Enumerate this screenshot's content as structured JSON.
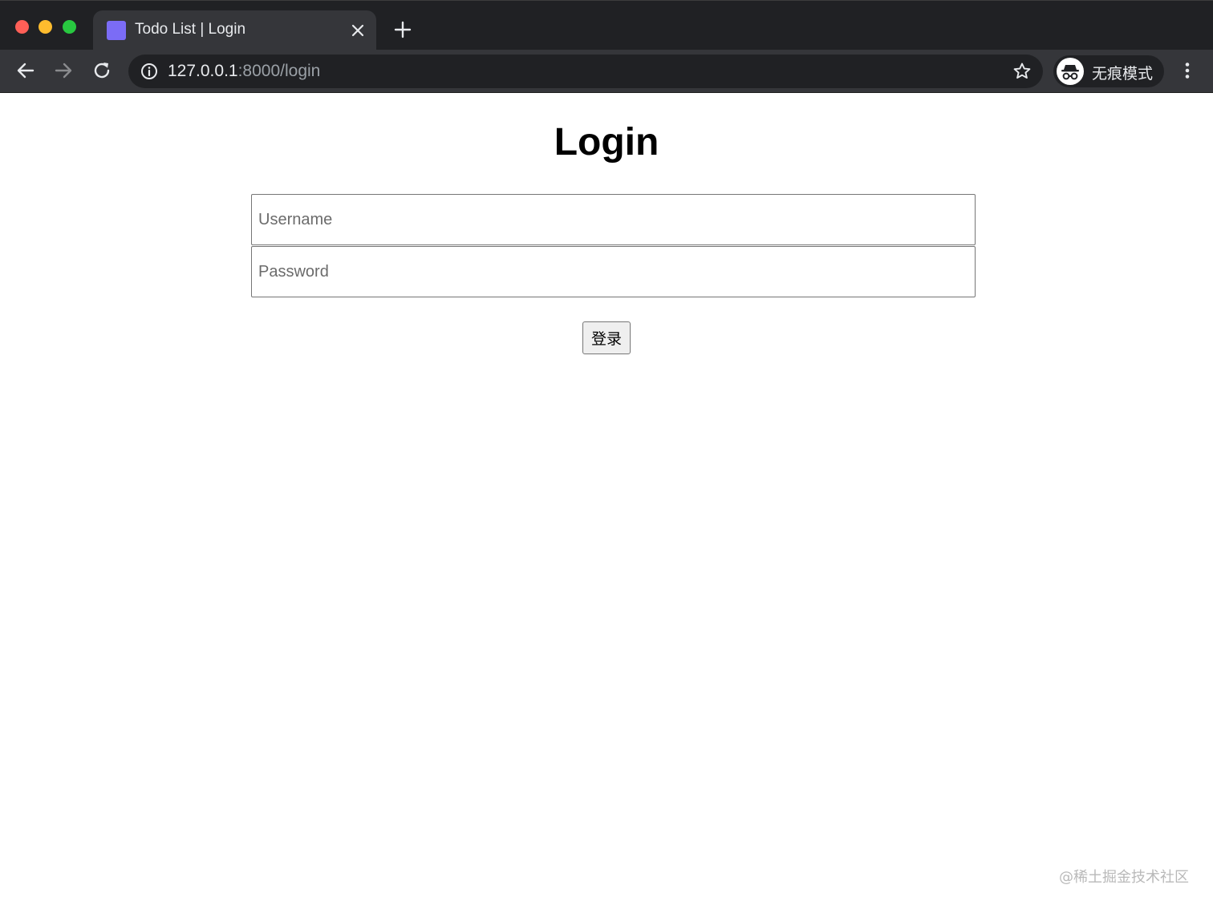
{
  "browser": {
    "tab": {
      "title": "Todo List | Login",
      "favicon_color": "#7b6cf6"
    },
    "address_bar": {
      "host": "127.0.0.1",
      "path": ":8000/login"
    },
    "incognito_label": "无痕模式",
    "icons": {
      "back": "arrow-left-icon",
      "forward": "arrow-right-icon",
      "reload": "reload-icon",
      "info": "info-icon",
      "bookmark": "star-icon",
      "incognito": "incognito-icon",
      "menu": "kebab-menu-icon",
      "tab_close": "close-icon",
      "new_tab": "plus-icon"
    }
  },
  "login": {
    "heading": "Login",
    "username_placeholder": "Username",
    "password_placeholder": "Password",
    "submit_label": "登录"
  },
  "watermark": "@稀土掘金技术社区"
}
